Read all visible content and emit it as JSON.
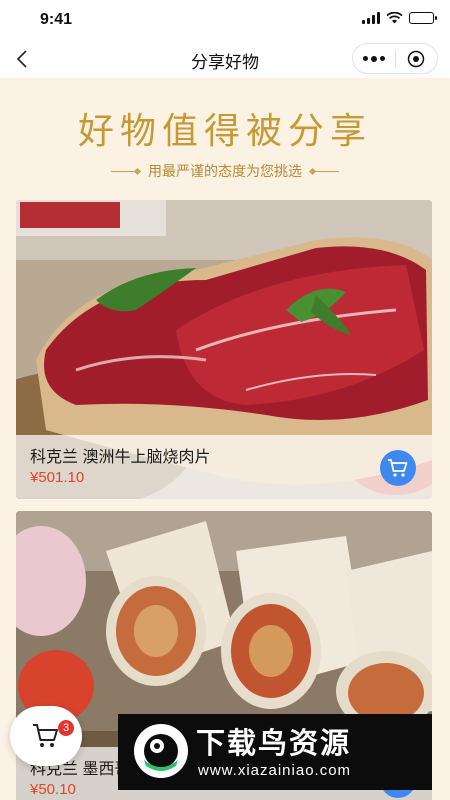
{
  "status_bar": {
    "time": "9:41"
  },
  "nav": {
    "title": "分享好物"
  },
  "header": {
    "title": "好物值得被分享",
    "subtitle": "用最严谨的态度为您挑选"
  },
  "products": [
    {
      "name": "科克兰 澳洲牛上脑烧肉片",
      "price": "¥501.10",
      "image": "beef-slices-photo"
    },
    {
      "name": "科克兰 墨西哥卷饼",
      "price": "¥50.10",
      "image": "burrito-wraps-photo"
    }
  ],
  "cart": {
    "count": "3"
  },
  "watermark": {
    "text": "下载鸟资源",
    "url": "www.xiazainiao.com"
  },
  "colors": {
    "background": "#fbf2e4",
    "gold": "#c59a35",
    "price": "#e0452a",
    "cart_button": "#3f88f0",
    "badge": "#e3342f"
  }
}
